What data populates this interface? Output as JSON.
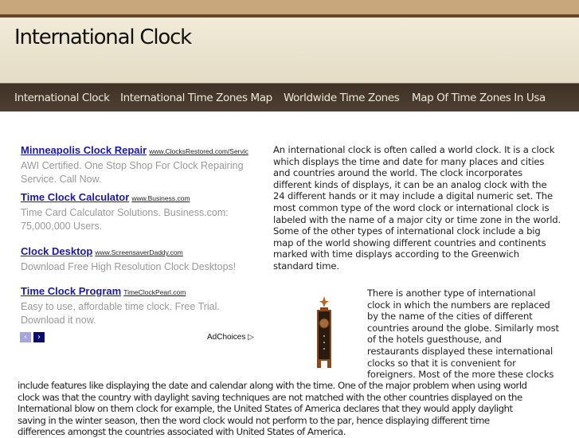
{
  "site": {
    "title": "International Clock"
  },
  "nav": [
    "International Clock",
    "International Time Zones Map",
    "Worldwide Time Zones",
    "Map Of Time Zones In Usa"
  ],
  "ads": [
    {
      "title": "Minneapolis Clock Repair",
      "url": "www.ClocksRestored.com/Servic",
      "desc": [
        "AWI Certified. One Stop Shop For Clock Repairing",
        "Service. Call Now."
      ]
    },
    {
      "title": "Time Clock Calculator",
      "url": "www.Business.com",
      "desc": [
        "Time Card Calculator Solutions. Business.com:",
        "75,000,000 Users."
      ]
    },
    {
      "title": "Clock Desktop",
      "url": "www.ScreensaverDaddy.com",
      "desc": [
        "Download Free High Resolution Clock Desktops!"
      ]
    },
    {
      "title": "Time Clock Program",
      "url": "TimeClockPearl.com",
      "desc": [
        "Easy to use, affordable time clock. Free Trial.",
        "Download it now."
      ]
    }
  ],
  "adnav": {
    "prev": "‹",
    "next": "›",
    "adchoices": "AdChoices ▷"
  },
  "article": {
    "p1": [
      "An international clock is often called a world clock. It is a clock",
      "which displays the time and date for many places and cities",
      "and countries around the world. The clock incorporates",
      "different kinds of displays, it can be an analog clock with the",
      "24 different hands or it may include a digital numeric set. The",
      "most common type of the word clock or international clock is",
      "labeled with the name of a major city or time zone in the world.",
      "Some of the other types of international clock include a big",
      "map of the world showing different countries and continents",
      "marked with time displays according to the Greenwich",
      "standard time."
    ],
    "p2_wrapped": [
      "There is another type of international",
      "clock in which the numbers are replaced",
      "by the name of the cities of different",
      "countries around the globe. Similarly most",
      "of the hotels guesthouse, and",
      "restaurants displayed these international",
      "clocks so that it is convenient for",
      "foreigners. Most of the more these clocks"
    ],
    "p2_full": [
      "include features like displaying the date and calendar along with the time. One of the major problem when using world",
      "clock was that the country with daylight saving techniques are not matched with the other countries displayed on the",
      "International blow on them clock for example, the United States of America declares that they would apply daylight",
      "saving in the winter season, then the word clock would not perform to the par, hence displaying different time",
      "differences amongst the countries associated with United States of America."
    ]
  }
}
